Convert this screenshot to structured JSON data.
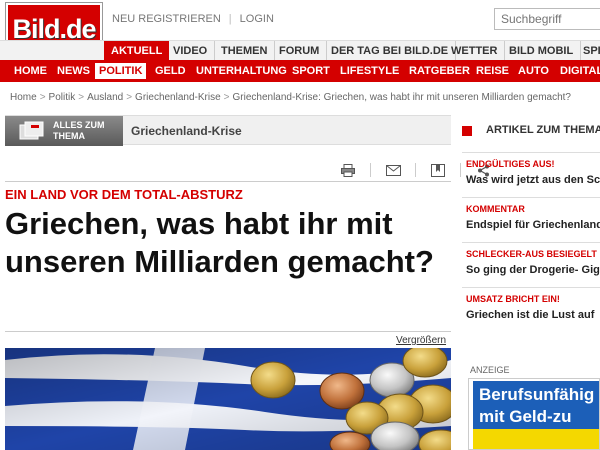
{
  "brand": {
    "logo": "Bild.de"
  },
  "toplinks": {
    "register": "NEU REGISTRIEREN",
    "separator": "|",
    "login": "LOGIN"
  },
  "search": {
    "placeholder": "Suchbegriff"
  },
  "nav_primary": [
    {
      "label": "AKTUELL",
      "active": true
    },
    {
      "label": "VIDEO"
    },
    {
      "label": "THEMEN"
    },
    {
      "label": "FORUM"
    },
    {
      "label": "DER TAG BEI BILD.DE"
    },
    {
      "label": "WETTER"
    },
    {
      "label": "BILD MOBIL"
    },
    {
      "label": "SPIEL"
    }
  ],
  "nav_secondary": [
    {
      "label": "HOME"
    },
    {
      "label": "NEWS"
    },
    {
      "label": "POLITIK",
      "active": true
    },
    {
      "label": "GELD"
    },
    {
      "label": "UNTERHALTUNG"
    },
    {
      "label": "SPORT"
    },
    {
      "label": "LIFESTYLE"
    },
    {
      "label": "RATGEBER"
    },
    {
      "label": "REISE"
    },
    {
      "label": "AUTO"
    },
    {
      "label": "DIGITAL"
    }
  ],
  "breadcrumb": {
    "items": [
      "Home",
      "Politik",
      "Ausland",
      "Griechenland-Krise",
      "Griechenland-Krise: Griechen, was habt ihr mit unseren Milliarden gemacht?"
    ],
    "separator": ">"
  },
  "theme": {
    "button_line1": "ALLES ZUM",
    "button_line2": "THEMA",
    "title": "Griechenland-Krise"
  },
  "article": {
    "kicker": "EIN LAND VOR DEM TOTAL-ABSTURZ",
    "headline": "Griechen, was habt ihr mit unseren Milliarden gemacht?",
    "enlarge": "Vergrößern"
  },
  "sidebar": {
    "header": "ARTIKEL ZUM THEMA",
    "items": [
      {
        "kicker": "ENDGÜLTIGES AUS!",
        "headline": "Was wird jetzt aus den Sch"
      },
      {
        "kicker": "KOMMENTAR",
        "headline": "Endspiel für Griechenland"
      },
      {
        "kicker": "SCHLECKER-AUS BESIEGELT",
        "headline": "So ging der Drogerie- Gig"
      },
      {
        "kicker": "UMSATZ BRICHT EIN!",
        "headline": "Griechen ist die Lust auf"
      }
    ]
  },
  "ad": {
    "label": "ANZEIGE",
    "line1": "Berufsunfähig",
    "line2": "mit Geld-zu"
  },
  "colors": {
    "brand_red": "#d40000",
    "nav_grey": "#f2f2f2",
    "ad_blue": "#1c5fb8",
    "ad_yellow": "#f4d800"
  }
}
